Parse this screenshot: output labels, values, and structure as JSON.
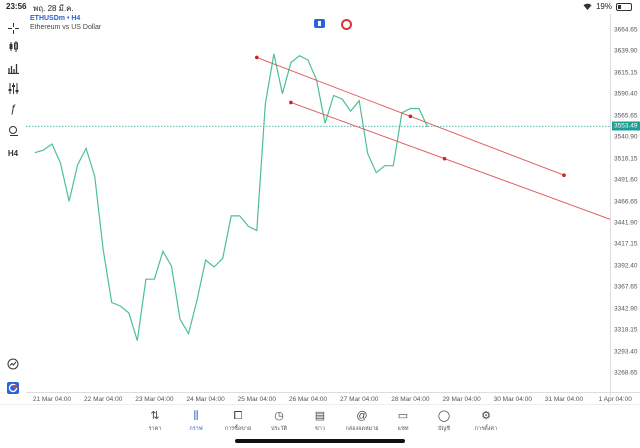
{
  "status_bar": {
    "time": "23:56",
    "date": "พฤ. 28 มี.ค.",
    "battery": "19%",
    "icons": [
      "wifi-icon",
      "battery-icon"
    ]
  },
  "symbol": {
    "name": "ETHUSDm • H4",
    "description": "Ethereum vs US Dollar"
  },
  "left_tools": [
    "crosshair-icon",
    "candlestick-icon",
    "bar-chart-icon",
    "indicators-icon",
    "function-icon",
    "drawing-tools-icon",
    "H4"
  ],
  "bottom_left_tools": [
    "search-chart-icon",
    "logo-icon"
  ],
  "price_axis": {
    "labels": [
      "3664.65",
      "3639.90",
      "3615.15",
      "3590.40",
      "3565.65",
      "3540.90",
      "3516.15",
      "3491.60",
      "3466.65",
      "3441.90",
      "3417.15",
      "3392.40",
      "3367.65",
      "3342.90",
      "3318.15",
      "3293.40",
      "3268.65"
    ],
    "current": "3553.49"
  },
  "time_axis": {
    "labels": [
      "21 Mar 04:00",
      "22 Mar 04:00",
      "23 Mar 04:00",
      "24 Mar 04:00",
      "25 Mar 04:00",
      "26 Mar 04:00",
      "27 Mar 04:00",
      "28 Mar 04:00",
      "29 Mar 04:00",
      "30 Mar 04:00",
      "31 Mar 04:00",
      "1 Apr 04:00"
    ]
  },
  "bottom_nav": [
    {
      "label": "ราคา",
      "icon": "quotes-icon"
    },
    {
      "label": "กราฟ",
      "icon": "chart-icon",
      "active": true
    },
    {
      "label": "การซื้อขาย",
      "icon": "trade-icon"
    },
    {
      "label": "ประวัติ",
      "icon": "history-icon"
    },
    {
      "label": "ข่าว",
      "icon": "news-icon"
    },
    {
      "label": "กล่องจดหมาย",
      "icon": "mailbox-icon"
    },
    {
      "label": "แชท",
      "icon": "chat-icon"
    },
    {
      "label": "บัญชี",
      "icon": "account-icon"
    },
    {
      "label": "การตั้งค่า",
      "icon": "settings-icon"
    }
  ],
  "colors": {
    "line": "#4cbf99",
    "trendline": "#e05555",
    "current_price": "#1e9e94",
    "accent": "#2a62d8"
  },
  "chart_data": {
    "type": "line",
    "series": [
      {
        "x": [
          "20 Mar 20:00",
          "21 Mar 00:00",
          "21 Mar 04:00",
          "21 Mar 08:00",
          "21 Mar 12:00",
          "21 Mar 16:00",
          "21 Mar 20:00",
          "22 Mar 00:00",
          "22 Mar 04:00",
          "22 Mar 08:00",
          "22 Mar 12:00",
          "22 Mar 16:00",
          "22 Mar 20:00",
          "23 Mar 00:00",
          "23 Mar 04:00",
          "23 Mar 08:00",
          "23 Mar 12:00",
          "23 Mar 16:00",
          "23 Mar 20:00",
          "24 Mar 00:00",
          "24 Mar 04:00",
          "24 Mar 08:00",
          "24 Mar 12:00",
          "24 Mar 16:00",
          "24 Mar 20:00",
          "25 Mar 00:00",
          "25 Mar 04:00",
          "25 Mar 08:00",
          "25 Mar 12:00",
          "25 Mar 16:00",
          "25 Mar 20:00",
          "26 Mar 00:00",
          "26 Mar 04:00",
          "26 Mar 08:00",
          "26 Mar 12:00",
          "26 Mar 16:00",
          "26 Mar 20:00",
          "27 Mar 00:00",
          "27 Mar 04:00",
          "27 Mar 08:00",
          "27 Mar 12:00",
          "27 Mar 16:00",
          "27 Mar 20:00",
          "28 Mar 00:00",
          "28 Mar 04:00",
          "28 Mar 08:00",
          "28 Mar 12:00"
        ],
        "y": [
          3523,
          3526,
          3533,
          3511,
          3467,
          3509,
          3528,
          3496,
          3411,
          3350,
          3346,
          3338,
          3306,
          3377,
          3377,
          3409,
          3392,
          3331,
          3314,
          3353,
          3399,
          3391,
          3401,
          3450,
          3450,
          3438,
          3433,
          3579,
          3637,
          3591,
          3627,
          3635,
          3630,
          3607,
          3557,
          3589,
          3585,
          3571,
          3583,
          3522,
          3500,
          3508,
          3508,
          3569,
          3574,
          3574,
          3553
        ]
      }
    ],
    "trendlines": [
      {
        "from": [
          "25 Mar 04:00",
          3633
        ],
        "to": [
          "31 Mar 04:00",
          3497
        ]
      },
      {
        "from": [
          "25 Mar 20:00",
          3581
        ],
        "to": [
          "1 Apr 04:00",
          3444
        ]
      }
    ],
    "current_price": 3553.49,
    "ylim": [
      3268.65,
      3664.65
    ],
    "grid": false
  }
}
